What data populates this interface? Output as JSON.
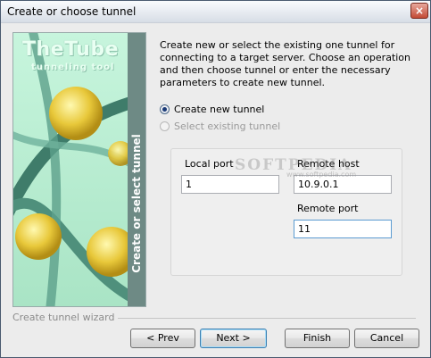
{
  "window": {
    "title": "Create or choose tunnel",
    "close_symbol": "×"
  },
  "banner": {
    "brand_title": "TheTube",
    "brand_subtitle": "tunneling tool",
    "side_label": "Create or select tunnel"
  },
  "description": "Create new or select the existing one tunnel for connecting to a target server. Choose an operation and then choose tunnel or enter the necessary parameters to create new tunnel.",
  "options": {
    "create_new": {
      "label": "Create new tunnel",
      "checked": true,
      "enabled": true
    },
    "select_existing": {
      "label": "Select existing tunnel",
      "checked": false,
      "enabled": false
    }
  },
  "params": {
    "local_port_label": "Local port",
    "local_port_value": "1",
    "remote_host_label": "Remote host",
    "remote_host_value": "10.9.0.1",
    "remote_port_label": "Remote port",
    "remote_port_value": "11"
  },
  "watermark": {
    "text": "SOFTPEDIA",
    "sub": "www.softpedia.com"
  },
  "footer": {
    "caption": "Create tunnel wizard",
    "prev_label": "< Prev",
    "next_label": "Next >",
    "finish_label": "Finish",
    "cancel_label": "Cancel"
  }
}
